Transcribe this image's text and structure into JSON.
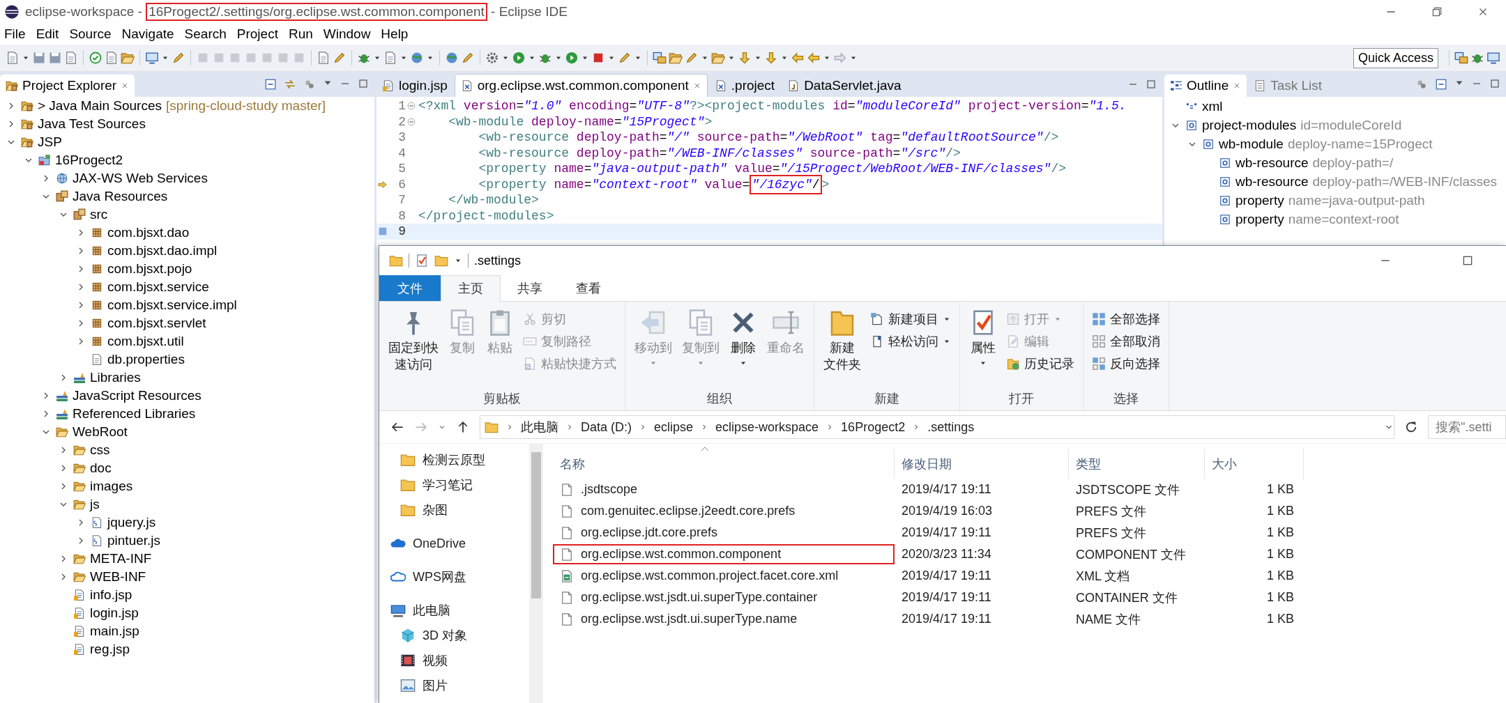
{
  "window": {
    "title_prefix": "eclipse-workspace - ",
    "title_highlight": "16Progect2/.settings/org.eclipse.wst.common.component",
    "title_suffix": " - Eclipse IDE"
  },
  "menu": [
    "File",
    "Edit",
    "Source",
    "Navigate",
    "Search",
    "Project",
    "Run",
    "Window",
    "Help"
  ],
  "toolbar": {
    "quick_access": "Quick Access"
  },
  "project_explorer": {
    "title": "Project Explorer",
    "items": [
      {
        "label": "> Java Main Sources",
        "decoration": "[spring-cloud-study master]",
        "kind": "source-folder",
        "expanded": false
      },
      {
        "label": "Java Test Sources",
        "kind": "source-folder",
        "expanded": false
      },
      {
        "label": "JSP",
        "kind": "source-folder",
        "expanded": true,
        "children": [
          {
            "label": "16Progect2",
            "kind": "project",
            "expanded": true,
            "children": [
              {
                "label": "JAX-WS Web Services",
                "kind": "services",
                "expanded": false
              },
              {
                "label": "Java Resources",
                "kind": "java-resources",
                "expanded": true,
                "children": [
                  {
                    "label": "src",
                    "kind": "package-root",
                    "expanded": true,
                    "children": [
                      {
                        "label": "com.bjsxt.dao",
                        "kind": "package",
                        "expanded": false
                      },
                      {
                        "label": "com.bjsxt.dao.impl",
                        "kind": "package",
                        "expanded": false
                      },
                      {
                        "label": "com.bjsxt.pojo",
                        "kind": "package",
                        "expanded": false
                      },
                      {
                        "label": "com.bjsxt.service",
                        "kind": "package",
                        "expanded": false
                      },
                      {
                        "label": "com.bjsxt.service.impl",
                        "kind": "package",
                        "expanded": false
                      },
                      {
                        "label": "com.bjsxt.servlet",
                        "kind": "package",
                        "expanded": false
                      },
                      {
                        "label": "com.bjsxt.util",
                        "kind": "package",
                        "expanded": false
                      },
                      {
                        "label": "db.properties",
                        "kind": "file"
                      }
                    ]
                  },
                  {
                    "label": "Libraries",
                    "kind": "library",
                    "expanded": false
                  }
                ]
              },
              {
                "label": "JavaScript Resources",
                "kind": "library",
                "expanded": false
              },
              {
                "label": "Referenced Libraries",
                "kind": "library",
                "expanded": false
              },
              {
                "label": "WebRoot",
                "kind": "folder",
                "expanded": true,
                "children": [
                  {
                    "label": "css",
                    "kind": "folder",
                    "expanded": false
                  },
                  {
                    "label": "doc",
                    "kind": "folder",
                    "expanded": false
                  },
                  {
                    "label": "images",
                    "kind": "folder",
                    "expanded": false
                  },
                  {
                    "label": "js",
                    "kind": "folder",
                    "expanded": true,
                    "children": [
                      {
                        "label": "jquery.js",
                        "kind": "script",
                        "expanded": false
                      },
                      {
                        "label": "pintuer.js",
                        "kind": "script",
                        "expanded": false
                      }
                    ]
                  },
                  {
                    "label": "META-INF",
                    "kind": "folder",
                    "expanded": false
                  },
                  {
                    "label": "WEB-INF",
                    "kind": "folder",
                    "expanded": false
                  },
                  {
                    "label": "info.jsp",
                    "kind": "page"
                  },
                  {
                    "label": "login.jsp",
                    "kind": "page"
                  },
                  {
                    "label": "main.jsp",
                    "kind": "page"
                  },
                  {
                    "label": "reg.jsp",
                    "kind": "page"
                  }
                ]
              }
            ]
          }
        ]
      }
    ]
  },
  "editor": {
    "tabs": [
      {
        "label": "login.jsp",
        "kind": "page",
        "selected": false
      },
      {
        "label": "org.eclipse.wst.common.component",
        "kind": "xml",
        "selected": true
      },
      {
        "label": ".project",
        "kind": "xml",
        "selected": false
      },
      {
        "label": "DataServlet.java",
        "kind": "java",
        "selected": false
      }
    ],
    "lines": [
      {
        "number": "1",
        "text": "<?xml version=\"1.0\" encoding=\"UTF-8\"?><project-modules id=\"moduleCoreId\" project-version=\"1.5.",
        "foldable": true,
        "marked": false,
        "current": false
      },
      {
        "number": "2",
        "text": "    <wb-module deploy-name=\"15Progect\">",
        "foldable": true,
        "marked": false,
        "current": false
      },
      {
        "number": "3",
        "text": "        <wb-resource deploy-path=\"/\" source-path=\"/WebRoot\" tag=\"defaultRootSource\"/>",
        "foldable": false,
        "marked": false,
        "current": false
      },
      {
        "number": "4",
        "text": "        <wb-resource deploy-path=\"/WEB-INF/classes\" source-path=\"/src\"/>",
        "foldable": false,
        "marked": false,
        "current": false
      },
      {
        "number": "5",
        "text": "        <property name=\"java-output-path\" value=\"/15Progect/WebRoot/WEB-INF/classes\"/>",
        "foldable": false,
        "marked": false,
        "current": false
      },
      {
        "number": "6",
        "text": "        <property name=\"context-root\" value=",
        "highlight": "\"/16zyc\"/",
        "tail": ">",
        "foldable": false,
        "marked": true,
        "current": false
      },
      {
        "number": "7",
        "text": "    </wb-module>",
        "foldable": false,
        "marked": false,
        "current": false
      },
      {
        "number": "8",
        "text": "</project-modules>",
        "foldable": false,
        "marked": false,
        "current": false
      },
      {
        "number": "9",
        "foldable": false,
        "marked": false,
        "current": true
      }
    ]
  },
  "outline": {
    "tabs": [
      {
        "label": "Outline",
        "selected": true
      },
      {
        "label": "Task List",
        "selected": false
      }
    ],
    "items": [
      {
        "name": "xml",
        "kind": "declaration"
      },
      {
        "name": "project-modules",
        "detail": "id=moduleCoreId",
        "kind": "element",
        "expanded": true,
        "children": [
          {
            "name": "wb-module",
            "detail": "deploy-name=15Progect",
            "kind": "element",
            "expanded": true,
            "children": [
              {
                "name": "wb-resource",
                "detail": "deploy-path=/",
                "kind": "element"
              },
              {
                "name": "wb-resource",
                "detail": "deploy-path=/WEB-INF/classes",
                "kind": "element"
              },
              {
                "name": "property",
                "detail": "name=java-output-path",
                "kind": "element"
              },
              {
                "name": "property",
                "detail": "name=context-root",
                "kind": "element"
              }
            ]
          }
        ]
      }
    ]
  },
  "file_explorer": {
    "title": ".settings",
    "ribbon_tabs": [
      {
        "label": "文件",
        "kind": "menu",
        "selected": false
      },
      {
        "label": "主页",
        "kind": "tab",
        "selected": true
      },
      {
        "label": "共享",
        "kind": "tab",
        "selected": false
      },
      {
        "label": "查看",
        "kind": "tab",
        "selected": false
      }
    ],
    "groups": [
      {
        "label": "剪贴板",
        "buttons": [
          {
            "label": [
              "固定到快",
              "速访问"
            ],
            "kind": "large",
            "disabled": false,
            "dropdown": false
          },
          {
            "label": "复制",
            "kind": "large",
            "disabled": true,
            "dropdown": false
          },
          {
            "label": "粘贴",
            "kind": "large",
            "disabled": true,
            "dropdown": false
          },
          {
            "label": "剪切",
            "kind": "small",
            "disabled": true,
            "dropdown": false
          },
          {
            "label": "复制路径",
            "kind": "small",
            "disabled": true,
            "dropdown": false
          },
          {
            "label": "粘贴快捷方式",
            "kind": "small",
            "disabled": true,
            "dropdown": false
          }
        ]
      },
      {
        "label": "组织",
        "buttons": [
          {
            "label": "移动到",
            "kind": "large",
            "disabled": true,
            "dropdown": true
          },
          {
            "label": "复制到",
            "kind": "large",
            "disabled": true,
            "dropdown": true
          },
          {
            "label": "删除",
            "kind": "large",
            "disabled": false,
            "dropdown": true
          },
          {
            "label": "重命名",
            "kind": "large",
            "disabled": true,
            "dropdown": false
          }
        ]
      },
      {
        "label": "新建",
        "buttons": [
          {
            "label": [
              "新建",
              "文件夹"
            ],
            "kind": "large",
            "disabled": false,
            "dropdown": false
          },
          {
            "label": "新建项目",
            "kind": "small",
            "disabled": false,
            "dropdown": true
          },
          {
            "label": "轻松访问",
            "kind": "small",
            "disabled": false,
            "dropdown": true
          }
        ]
      },
      {
        "label": "打开",
        "buttons": [
          {
            "label": "属性",
            "kind": "large",
            "disabled": false,
            "dropdown": true
          },
          {
            "label": "打开",
            "kind": "small",
            "disabled": true,
            "dropdown": true
          },
          {
            "label": "编辑",
            "kind": "small",
            "disabled": true,
            "dropdown": false
          },
          {
            "label": "历史记录",
            "kind": "small",
            "disabled": false,
            "dropdown": false
          }
        ]
      },
      {
        "label": "选择",
        "buttons": [
          {
            "label": "全部选择",
            "kind": "small",
            "disabled": false,
            "dropdown": false
          },
          {
            "label": "全部取消",
            "kind": "small",
            "disabled": false,
            "dropdown": false
          },
          {
            "label": "反向选择",
            "kind": "small",
            "disabled": false,
            "dropdown": false
          }
        ]
      }
    ],
    "path": [
      "此电脑",
      "Data (D:)",
      "eclipse",
      "eclipse-workspace",
      "16Progect2",
      ".settings"
    ],
    "search_placeholder": "搜索\".setti",
    "nav": [
      {
        "label": "检测云原型",
        "kind": "folder"
      },
      {
        "label": "学习笔记",
        "kind": "folder"
      },
      {
        "label": "杂图",
        "kind": "folder"
      },
      {
        "label": "OneDrive",
        "kind": "onedrive"
      },
      {
        "label": "WPS网盘",
        "kind": "cloud"
      },
      {
        "label": "此电脑",
        "kind": "pc"
      },
      {
        "label": "3D 对象",
        "kind": "objects"
      },
      {
        "label": "视频",
        "kind": "video"
      },
      {
        "label": "图片",
        "kind": "pictures"
      }
    ],
    "columns": [
      {
        "label": "名称",
        "sorted": true
      },
      {
        "label": "修改日期",
        "sorted": false
      },
      {
        "label": "类型",
        "sorted": false
      },
      {
        "label": "大小",
        "sorted": false
      }
    ],
    "files": [
      {
        "name": ".jsdtscope",
        "date": "2019/4/17 19:11",
        "type": "JSDTSCOPE 文件",
        "size": "1 KB",
        "kind": "file",
        "highlight": false
      },
      {
        "name": "com.genuitec.eclipse.j2eedt.core.prefs",
        "date": "2019/4/19 16:03",
        "type": "PREFS 文件",
        "size": "1 KB",
        "kind": "file",
        "highlight": false
      },
      {
        "name": "org.eclipse.jdt.core.prefs",
        "date": "2019/4/17 19:11",
        "type": "PREFS 文件",
        "size": "1 KB",
        "kind": "file",
        "highlight": false
      },
      {
        "name": "org.eclipse.wst.common.component",
        "date": "2020/3/23 11:34",
        "type": "COMPONENT 文件",
        "size": "1 KB",
        "kind": "file",
        "highlight": true
      },
      {
        "name": "org.eclipse.wst.common.project.facet.core.xml",
        "date": "2019/4/17 19:11",
        "type": "XML 文档",
        "size": "1 KB",
        "kind": "xml",
        "highlight": false
      },
      {
        "name": "org.eclipse.wst.jsdt.ui.superType.container",
        "date": "2019/4/17 19:11",
        "type": "CONTAINER 文件",
        "size": "1 KB",
        "kind": "file",
        "highlight": false
      },
      {
        "name": "org.eclipse.wst.jsdt.ui.superType.name",
        "date": "2019/4/17 19:11",
        "type": "NAME 文件",
        "size": "1 KB",
        "kind": "file",
        "highlight": false
      }
    ]
  }
}
